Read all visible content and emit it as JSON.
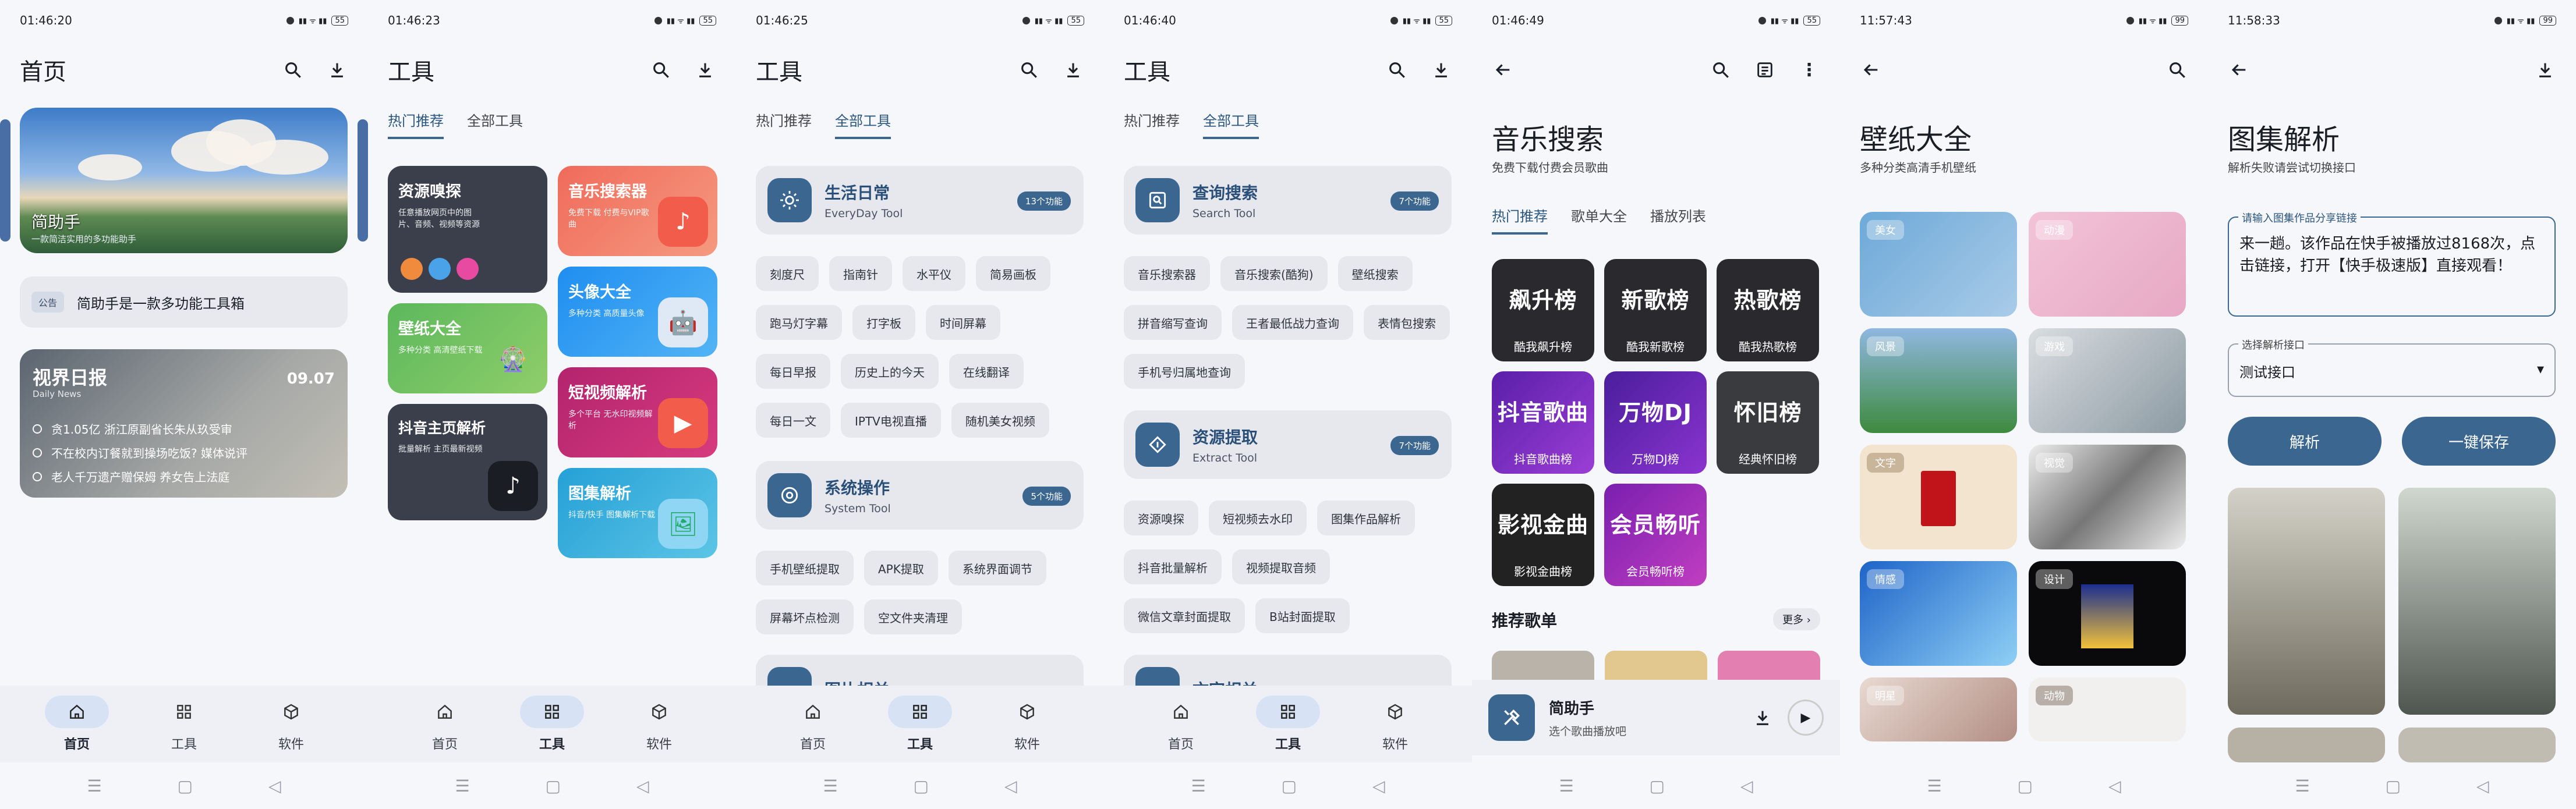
{
  "screens": [
    {
      "time": "01:46:20",
      "title": "首页",
      "hero": {
        "title": "简助手",
        "sub": "一款简洁实用的多功能助手"
      },
      "notice": {
        "badge": "公告",
        "text": "简助手是一款多功能工具箱"
      },
      "daily": {
        "title": "视界日报",
        "en": "Daily News",
        "date": "09.07",
        "items": [
          "贪1.05亿 浙江原副省长朱从玖受审",
          "不在校内订餐就到操场吃饭? 媒体说评",
          "老人千万遗产赠保姆 养女告上法庭"
        ]
      }
    },
    {
      "time": "01:46:23",
      "title": "工具",
      "tabs": [
        "热门推荐",
        "全部工具"
      ],
      "cards": [
        {
          "title": "资源嗅探",
          "sub": "任意播放网页中的图片、音频、视频等资源"
        },
        {
          "title": "音乐搜索器",
          "sub": "免费下载 付费与VIP歌曲"
        },
        {
          "title": "壁纸大全",
          "sub": "多种分类 高清壁纸下载"
        },
        {
          "title": "头像大全",
          "sub": "多种分类 高质量头像"
        },
        {
          "title": "抖音主页解析",
          "sub": "批量解析 主页最新视频"
        },
        {
          "title": "短视频解析",
          "sub": "多个平台 无水印视频解析"
        },
        {
          "title": "图集解析",
          "sub": "抖音/快手 图集解析下载"
        }
      ]
    },
    {
      "time": "01:46:25",
      "title": "工具",
      "tabs": [
        "热门推荐",
        "全部工具"
      ],
      "sections": [
        {
          "name": "生活日常",
          "en": "EveryDay Tool",
          "count": "13个功能",
          "chips": [
            "刻度尺",
            "指南针",
            "水平仪",
            "简易画板",
            "跑马灯字幕",
            "打字板",
            "时间屏幕",
            "每日早报",
            "历史上的今天",
            "在线翻译",
            "每日一文",
            "IPTV电视直播",
            "随机美女视频"
          ]
        },
        {
          "name": "系统操作",
          "en": "System Tool",
          "count": "5个功能",
          "chips": [
            "手机壁纸提取",
            "APK提取",
            "系统界面调节",
            "屏幕坏点检测",
            "空文件夹清理"
          ]
        },
        {
          "name": "图片相关",
          "en": "",
          "count": ""
        }
      ]
    },
    {
      "time": "01:46:40",
      "title": "工具",
      "tabs": [
        "热门推荐",
        "全部工具"
      ],
      "sections": [
        {
          "name": "查询搜索",
          "en": "Search Tool",
          "count": "7个功能",
          "chips": [
            "音乐搜索器",
            "音乐搜索(酷狗)",
            "壁纸搜索",
            "拼音缩写查询",
            "王者最低战力查询",
            "表情包搜索",
            "手机号归属地查询"
          ]
        },
        {
          "name": "资源提取",
          "en": "Extract Tool",
          "count": "7个功能",
          "chips": [
            "资源嗅探",
            "短视频去水印",
            "图集作品解析",
            "抖音批量解析",
            "视频提取音频",
            "微信文章封面提取",
            "B站封面提取"
          ]
        },
        {
          "name": "文字相关",
          "en": "",
          "count": ""
        }
      ]
    },
    {
      "time": "01:46:49",
      "title": "音乐搜索",
      "sub": "免费下载付费会员歌曲",
      "tabs": [
        "热门推荐",
        "歌单大全",
        "播放列表"
      ],
      "cards": [
        {
          "big": "飙升榜",
          "cap": "酷我飙升榜"
        },
        {
          "big": "新歌榜",
          "cap": "酷我新歌榜"
        },
        {
          "big": "热歌榜",
          "cap": "酷我热歌榜"
        },
        {
          "big": "抖音歌曲",
          "cap": "抖音歌曲榜"
        },
        {
          "big": "万物DJ",
          "cap": "万物DJ榜"
        },
        {
          "big": "怀旧榜",
          "cap": "经典怀旧榜"
        },
        {
          "big": "影视金曲",
          "cap": "影视金曲榜"
        },
        {
          "big": "会员畅听",
          "cap": "会员畅听榜"
        }
      ],
      "section": "推荐歌单",
      "more": "更多",
      "player": {
        "name": "简助手",
        "sub": "选个歌曲播放吧"
      }
    },
    {
      "time": "11:57:43",
      "title": "壁纸大全",
      "sub": "多种分类高清手机壁纸",
      "tags": [
        "美女",
        "动漫",
        "风景",
        "游戏",
        "文字",
        "视觉",
        "情感",
        "设计",
        "明星",
        "动物"
      ]
    },
    {
      "time": "11:58:33",
      "title": "图集解析",
      "sub": "解析失败请尝试切换接口",
      "input": {
        "label": "请输入图集作品分享链接",
        "value": "来一趟。该作品在快手被播放过8168次，点击链接，打开【快手极速版】直接观看！"
      },
      "select": {
        "label": "选择解析接口",
        "value": "测试接口"
      },
      "buttons": [
        "解析",
        "一键保存"
      ]
    }
  ],
  "nav": [
    "首页",
    "工具",
    "软件"
  ],
  "colors": {
    "accent": "#3a6690",
    "tab": "#2b567f"
  }
}
